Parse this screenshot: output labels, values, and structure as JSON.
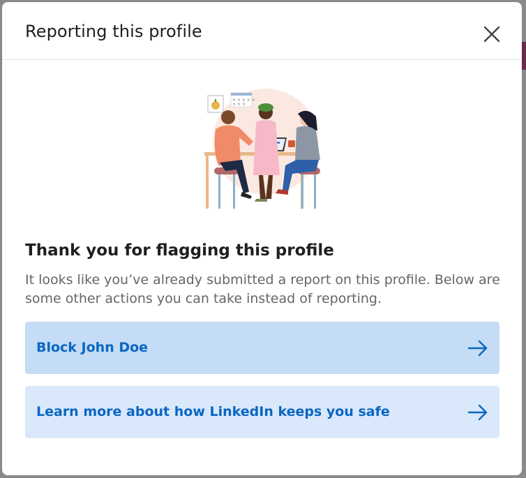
{
  "modal": {
    "title": "Reporting this profile",
    "close_icon": "close-icon"
  },
  "content": {
    "illustration": "three-people-at-table-illustration",
    "heading": "Thank you for flagging this profile",
    "description": "It looks like you’ve already submitted a report on this profile. Below are some other actions you can take instead of reporting."
  },
  "actions": [
    {
      "label": "Block John Doe",
      "icon": "arrow-right-icon"
    },
    {
      "label": "Learn more about how LinkedIn keeps you safe",
      "icon": "arrow-right-icon"
    }
  ],
  "colors": {
    "accent": "#0a66c2",
    "action_bg_primary": "#c4dcf5",
    "action_bg_secondary": "#d9e8fa"
  }
}
